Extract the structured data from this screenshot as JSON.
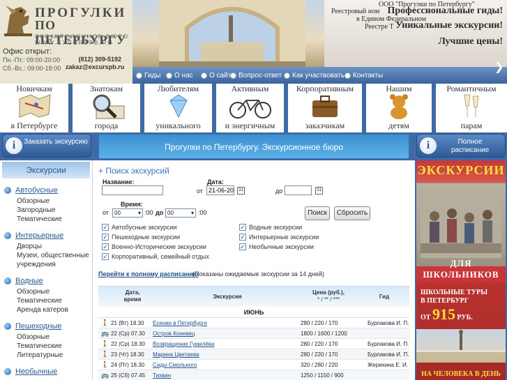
{
  "logo": {
    "line1": "ПРОГУЛКИ",
    "line2": "ПО ПЕТЕРБУРГУ",
    "line3": "ЭКСКУРСИОННОЕ БЮРО",
    "line4": "WWW.EXCURSPB.RU"
  },
  "office": {
    "title": "Офис открыт:",
    "hours1": "Пн.-Пт.: 09:00-20:00",
    "hours2": "Сб.-Вс.: 09:00-18:00",
    "phone": "(812) 309-5192",
    "email": "zakaz@excurspb.ru"
  },
  "headline": {
    "l1": "ООО \"Прогулки по Петербургу\"",
    "l2a": "Реестровый ном",
    "l2b": "Профессиональные гиды!",
    "l3": "в Едином Федеральном",
    "l4a": "Реестре Т",
    "l4b": "Уникальные экскурсии!",
    "l5": "Лучшие цены!"
  },
  "nav": [
    {
      "label": "Гиды"
    },
    {
      "label": "О нас"
    },
    {
      "label": "О сайте"
    },
    {
      "label": "Вопрос-ответ"
    },
    {
      "label": "Как участвовать"
    },
    {
      "label": "Контакты"
    }
  ],
  "categories": [
    {
      "top": "Новичкам",
      "bottom": "в Петербурге",
      "icon": "map-icon"
    },
    {
      "top": "Знатокам",
      "bottom": "города",
      "icon": "magnifier-icon"
    },
    {
      "top": "Любителям",
      "bottom": "уникального",
      "icon": "diamond-icon"
    },
    {
      "top": "Активным",
      "bottom": "и энергичным",
      "icon": "bicycle-icon"
    },
    {
      "top": "Корпоративным",
      "bottom": "заказчикам",
      "icon": "briefcase-icon"
    },
    {
      "top": "Нашим",
      "bottom": "детям",
      "icon": "teddy-bear-icon"
    },
    {
      "top": "Романтичным",
      "bottom": "парам",
      "icon": "champagne-icon"
    }
  ],
  "order_button": "Заказать экскурсию",
  "schedule_button": "Полное расписание",
  "banner": "Прогулки по Петербургу. Экскурсионное бюро",
  "sidebar": {
    "title": "Экскурсии",
    "sections": [
      {
        "label": "Автобусные",
        "items": [
          "Обзорные",
          "Загородные",
          "Тематические"
        ]
      },
      {
        "label": "Интерьерные",
        "items": [
          "Дворцы",
          "Музеи, общественные учреждения"
        ]
      },
      {
        "label": "Водные",
        "items": [
          "Обзорные",
          "Тематические",
          "Аренда катеров"
        ]
      },
      {
        "label": "Пешеходные",
        "items": [
          "Обзорные",
          "Тематические",
          "Литературные"
        ]
      },
      {
        "label": "Необычные",
        "items": []
      }
    ]
  },
  "search": {
    "title": "+ Поиск экскурсий",
    "name_label": "Название:",
    "name_value": "",
    "date_label": "Дата:",
    "from": "от",
    "to": "до",
    "date_from": "21-06-201",
    "date_to": "",
    "time_label": "Время:",
    "time_from_label": "от",
    "time_to_label": "до",
    "hour_from": "00",
    "hour_to": "00",
    "min_suffix": ":00",
    "search_button": "Поиск",
    "reset_button": "Сбросить",
    "checkboxes": [
      {
        "label": "Автобусные экскурсии",
        "checked": true
      },
      {
        "label": "Водные экскурсии",
        "checked": true
      },
      {
        "label": "Пешеходные экскурсии",
        "checked": true
      },
      {
        "label": "Интерьерные экскурсии",
        "checked": true
      },
      {
        "label": "Военно-Исторические экскурсии",
        "checked": true
      },
      {
        "label": "Необычные экскурсии",
        "checked": true
      },
      {
        "label": "Корпоративный, семейный отдых",
        "checked": true
      }
    ],
    "full_link": "Перейти к полному расписанию",
    "note": "(Показаны ожидаемые экскурсии за 14 дней)"
  },
  "table": {
    "headers": {
      "date": "Дата, время",
      "excursion": "Экскурсия",
      "price": "Цена (руб.),",
      "price_sub": "* / ** / ***",
      "guide": "Гид"
    },
    "month": "ИЮНЬ",
    "rows": [
      {
        "type": "walk",
        "date": "21 (Вт) 18.30",
        "name": "Есенин в Петербурге",
        "price": "280 / 220 / 170",
        "guide": "Бурлакова И. П."
      },
      {
        "type": "bus",
        "date": "22 (Ср) 07.30",
        "name": "Остров Коневец",
        "price": "1800 / 1600 / 1200",
        "guide": ""
      },
      {
        "type": "walk",
        "date": "22 (Ср) 18.30",
        "name": "Возвращение Гумилёва",
        "price": "280 / 220 / 170",
        "guide": "Бурлакова И. П."
      },
      {
        "type": "walk",
        "date": "23 (Чт) 18.30",
        "name": "Марина Цветаева",
        "price": "280 / 220 / 170",
        "guide": "Бурлакова И. П."
      },
      {
        "type": "walk",
        "date": "24 (Пт) 18.30",
        "name": "Сады Смольного",
        "price": "320 / 280 / 220",
        "guide": "Жерихина Е. И."
      },
      {
        "type": "bus",
        "date": "25 (Сб) 07.45",
        "name": "Тихвин",
        "price": "1250 / 1150 / 900",
        "guide": ""
      }
    ]
  },
  "promo1": {
    "top": "ЭКСКУРСИИ",
    "bottom": "ДЛЯ ШКОЛЬНИКОВ"
  },
  "promo2": {
    "l1": "ШКОЛЬНЫЕ ТУРЫ",
    "l2": "В ПЕТЕРБУРГ",
    "from": "ОТ",
    "price": "915",
    "unit": "РУБ.",
    "bottom": "НА ЧЕЛОВЕКА В ДЕНЬ"
  },
  "colors": {
    "brand": "#3f6aa5",
    "accent": "#3b8fd0",
    "link": "#1d4e8a",
    "promo": "#c9363a"
  }
}
